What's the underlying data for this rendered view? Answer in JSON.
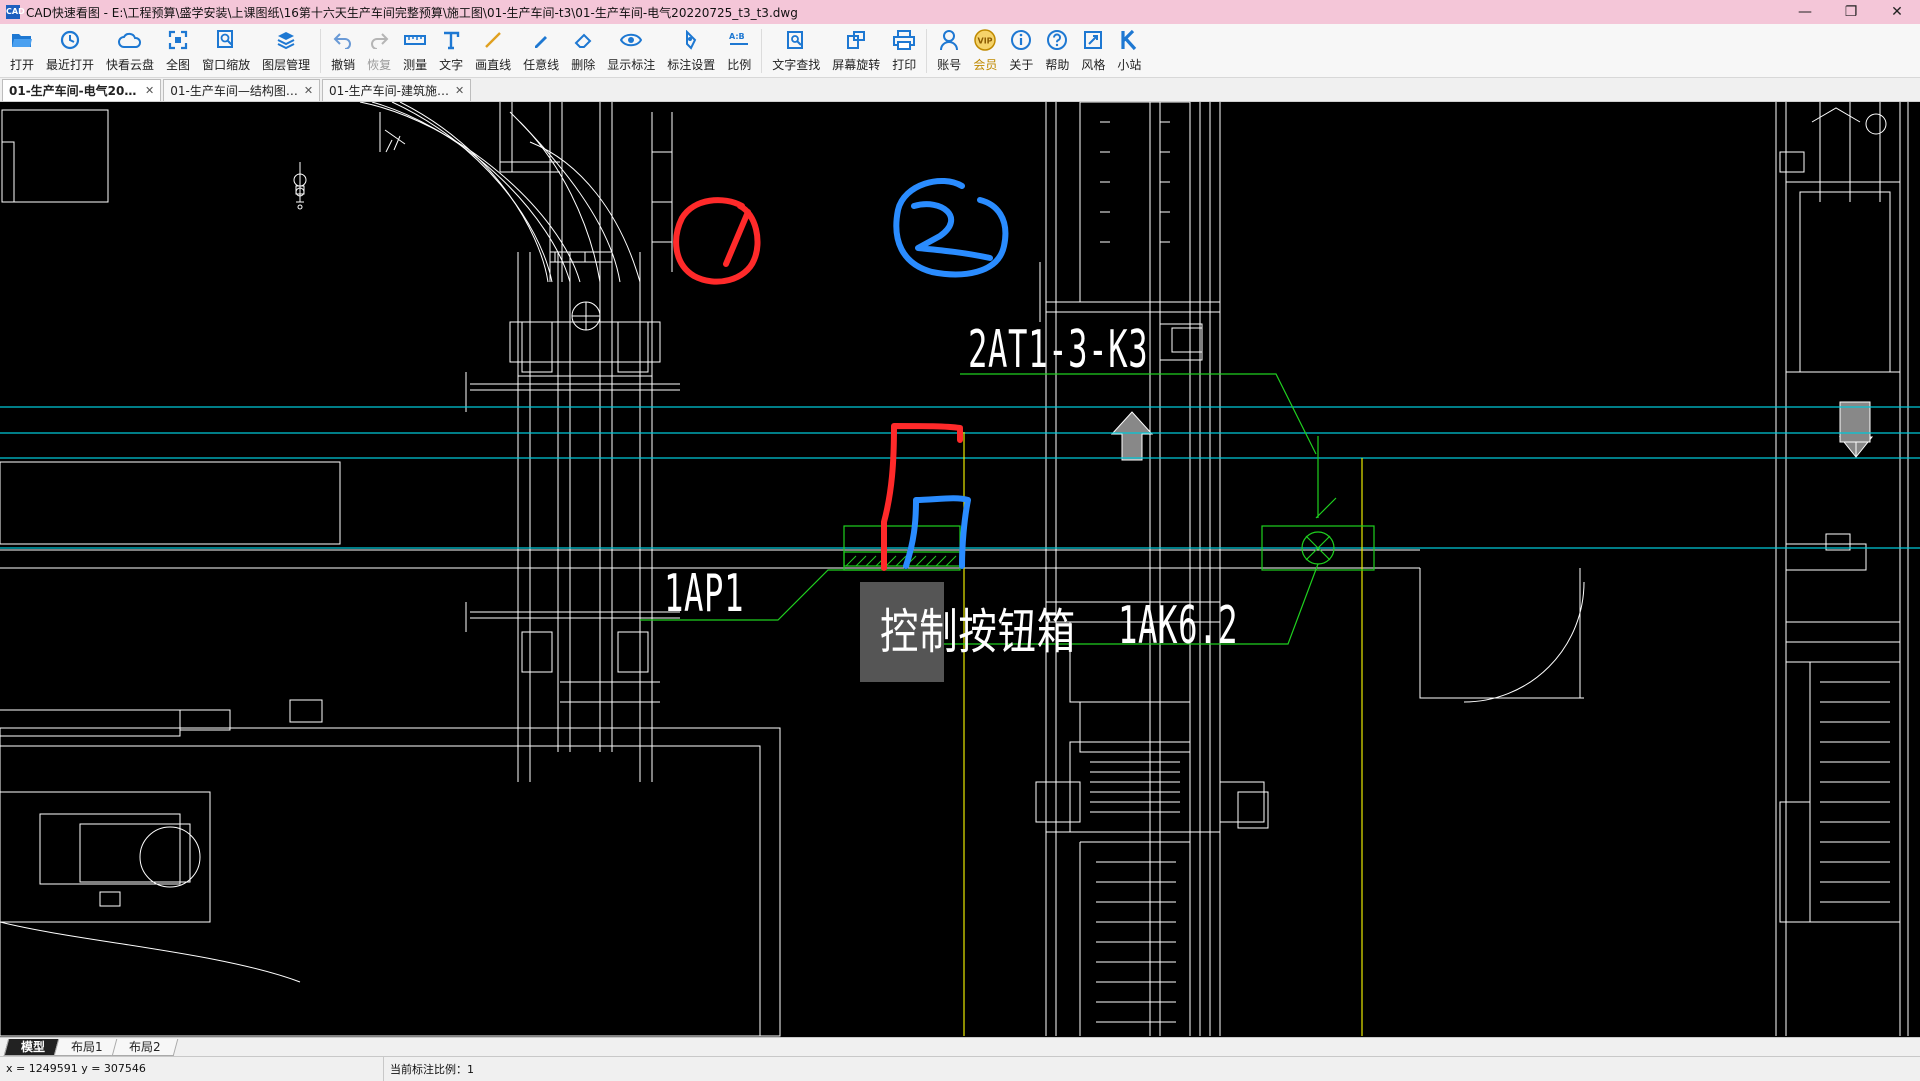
{
  "window": {
    "title": "CAD快速看图 - E:\\工程预算\\盛学安装\\上课图纸\\16第十六天生产车间完整预算\\施工图\\01-生产车间-t3\\01-生产车间-电气20220725_t3_t3.dwg",
    "app_icon_text": "CAD",
    "minimize": "—",
    "maximize": "❐",
    "close": "✕"
  },
  "toolbar": {
    "items": [
      {
        "label": "打开",
        "icon": "folder-open-icon"
      },
      {
        "label": "最近打开",
        "icon": "history-icon"
      },
      {
        "label": "快看云盘",
        "icon": "cloud-icon"
      },
      {
        "label": "全图",
        "icon": "fit-view-icon"
      },
      {
        "label": "窗口缩放",
        "icon": "zoom-window-icon"
      },
      {
        "label": "图层管理",
        "icon": "layers-icon"
      },
      {
        "label": "撤销",
        "icon": "undo-icon"
      },
      {
        "label": "恢复",
        "icon": "redo-icon"
      },
      {
        "label": "测量",
        "icon": "measure-icon"
      },
      {
        "label": "文字",
        "icon": "text-icon"
      },
      {
        "label": "画直线",
        "icon": "line-icon"
      },
      {
        "label": "任意线",
        "icon": "freehand-icon"
      },
      {
        "label": "删除",
        "icon": "eraser-icon"
      },
      {
        "label": "显示标注",
        "icon": "eye-icon"
      },
      {
        "label": "标注设置",
        "icon": "annotation-settings-icon"
      },
      {
        "label": "比例",
        "icon": "scale-icon"
      },
      {
        "label": "文字查找",
        "icon": "text-search-icon"
      },
      {
        "label": "屏幕旋转",
        "icon": "rotate-screen-icon"
      },
      {
        "label": "打印",
        "icon": "print-icon"
      },
      {
        "label": "账号",
        "icon": "account-icon"
      },
      {
        "label": "会员",
        "icon": "vip-icon"
      },
      {
        "label": "关于",
        "icon": "info-icon"
      },
      {
        "label": "帮助",
        "icon": "help-icon"
      },
      {
        "label": "风格",
        "icon": "style-icon"
      },
      {
        "label": "小站",
        "icon": "k-station-icon"
      }
    ]
  },
  "tabs": [
    {
      "label": "01-生产车间-电气202…",
      "close": "✕",
      "active": true
    },
    {
      "label": "01-生产车间—结构图…",
      "close": "✕",
      "active": false
    },
    {
      "label": "01-生产车间-建筑施…",
      "close": "✕",
      "active": false
    }
  ],
  "drawing": {
    "labels": {
      "label_2at": "2AT1-3-K3",
      "label_1ap1": "1AP1",
      "label_box": "控制按钮箱",
      "label_1ak": "1AK6.2"
    },
    "colors": {
      "background": "#000000",
      "linework": "#ffffff",
      "cyan": "#00c8d8",
      "green": "#1fd01f",
      "yellow": "#e8e800",
      "red_markup": "#ff2a2a",
      "blue_markup": "#2a8cff"
    }
  },
  "layout_tabs": [
    {
      "label": "模型",
      "active": true
    },
    {
      "label": "布局1",
      "active": false
    },
    {
      "label": "布局2",
      "active": false
    }
  ],
  "status": {
    "coords": "x = 1249591  y = 307546",
    "scale": "当前标注比例：1"
  }
}
